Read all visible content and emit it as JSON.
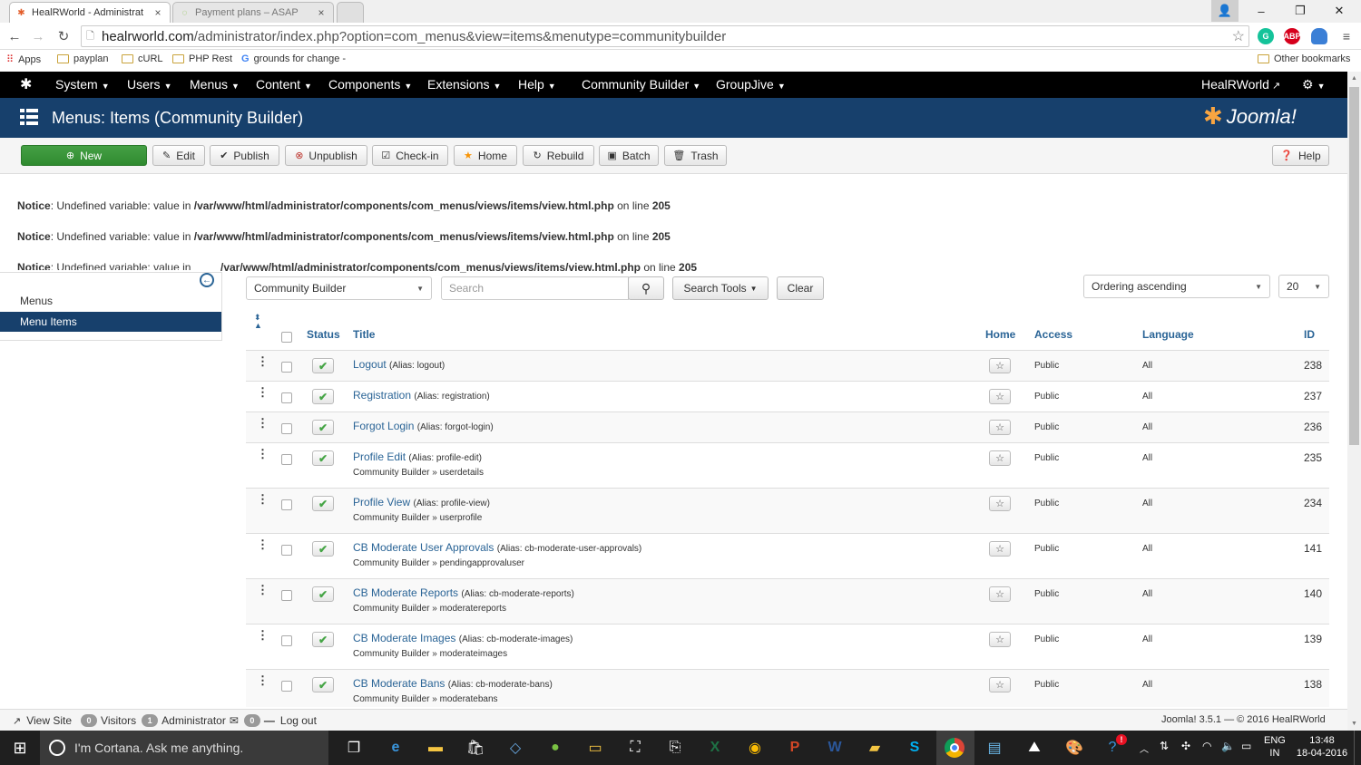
{
  "browser": {
    "tabs": [
      {
        "title": "HealRWorld - Administrat",
        "active": true
      },
      {
        "title": "Payment plans – ASAP",
        "active": false
      }
    ],
    "url_host": "healrworld.com",
    "url_path": "/administrator/index.php?option=com_menus&view=items&menutype=communitybuilder",
    "extensions": [
      "G",
      "ABP"
    ]
  },
  "bookmarks": [
    {
      "label": "Apps",
      "icon": "apps-grid-icon"
    },
    {
      "label": "payplan",
      "icon": "folder-icon"
    },
    {
      "label": "cURL",
      "icon": "folder-icon"
    },
    {
      "label": "PHP Rest",
      "icon": "folder-icon"
    },
    {
      "label": "grounds for change -",
      "icon": "google-g-icon"
    }
  ],
  "bookmarks_other": "Other bookmarks",
  "joomla_nav": {
    "items": [
      "System",
      "Users",
      "Menus",
      "Content",
      "Components",
      "Extensions",
      "Help",
      "Community Builder",
      "GroupJive"
    ],
    "site_link": "HealRWorld"
  },
  "title_bar": {
    "title": "Menus: Items (Community Builder)",
    "logo": "Joomla!"
  },
  "toolbar": {
    "new": "New",
    "edit": "Edit",
    "publish": "Publish",
    "unpublish": "Unpublish",
    "checkin": "Check-in",
    "home": "Home",
    "rebuild": "Rebuild",
    "batch": "Batch",
    "trash": "Trash",
    "help": "Help"
  },
  "notices": [
    {
      "label": "Notice",
      "text": ": Undefined variable: value in ",
      "path": "/var/www/html/administrator/components/com_menus/views/items/view.html.php",
      "online": " on line ",
      "line": "205"
    },
    {
      "label": "Notice",
      "text": ": Undefined variable: value in ",
      "path": "/var/www/html/administrator/components/com_menus/views/items/view.html.php",
      "online": " on line ",
      "line": "205"
    },
    {
      "label": "Notice",
      "text": ": Undefined variable: value in ",
      "path": "/var/www/html/administrator/components/com_menus/views/items/view.html.php",
      "online": " on line ",
      "line": "205"
    }
  ],
  "sidebar": {
    "items": [
      {
        "label": "Menus",
        "active": false
      },
      {
        "label": "Menu Items",
        "active": true
      }
    ]
  },
  "filters": {
    "menu_select": "Community Builder",
    "search_placeholder": "Search",
    "search_tools": "Search Tools",
    "clear": "Clear",
    "ordering": "Ordering ascending",
    "limit": "20"
  },
  "table": {
    "headers": {
      "status": "Status",
      "title": "Title",
      "home": "Home",
      "access": "Access",
      "language": "Language",
      "id": "ID"
    },
    "rows": [
      {
        "title": "Logout",
        "alias": "(Alias: logout)",
        "sub": "",
        "access": "Public",
        "language": "All",
        "id": "238"
      },
      {
        "title": "Registration",
        "alias": "(Alias: registration)",
        "sub": "",
        "access": "Public",
        "language": "All",
        "id": "237"
      },
      {
        "title": "Forgot Login",
        "alias": "(Alias: forgot-login)",
        "sub": "",
        "access": "Public",
        "language": "All",
        "id": "236"
      },
      {
        "title": "Profile Edit",
        "alias": "(Alias: profile-edit)",
        "sub": "Community Builder » userdetails",
        "access": "Public",
        "language": "All",
        "id": "235"
      },
      {
        "title": "Profile View",
        "alias": "(Alias: profile-view)",
        "sub": "Community Builder » userprofile",
        "access": "Public",
        "language": "All",
        "id": "234"
      },
      {
        "title": "CB Moderate User Approvals",
        "alias": "(Alias: cb-moderate-user-approvals)",
        "sub": "Community Builder » pendingapprovaluser",
        "access": "Public",
        "language": "All",
        "id": "141"
      },
      {
        "title": "CB Moderate Reports",
        "alias": "(Alias: cb-moderate-reports)",
        "sub": "Community Builder » moderatereports",
        "access": "Public",
        "language": "All",
        "id": "140"
      },
      {
        "title": "CB Moderate Images",
        "alias": "(Alias: cb-moderate-images)",
        "sub": "Community Builder » moderateimages",
        "access": "Public",
        "language": "All",
        "id": "139"
      },
      {
        "title": "CB Moderate Bans",
        "alias": "(Alias: cb-moderate-bans)",
        "sub": "Community Builder » moderatebans",
        "access": "Public",
        "language": "All",
        "id": "138"
      }
    ]
  },
  "statusbar": {
    "view_site": "View Site",
    "visitors_count": "0",
    "visitors": "Visitors",
    "admin_count": "1",
    "admin": "Administrator",
    "msg_count": "0",
    "logout": "Log out",
    "version": "Joomla! 3.5.1 — © 2016 HealRWorld"
  },
  "taskbar": {
    "cortana": "I'm Cortana. Ask me anything.",
    "lang1": "ENG",
    "lang2": "IN",
    "time": "13:48",
    "date": "18-04-2016"
  },
  "colors": {
    "joomla_nav": "#000000",
    "title_bar": "#17406c",
    "new_button": "#2f8a2f",
    "link": "#2a6496",
    "active_sidebar": "#17406c"
  }
}
